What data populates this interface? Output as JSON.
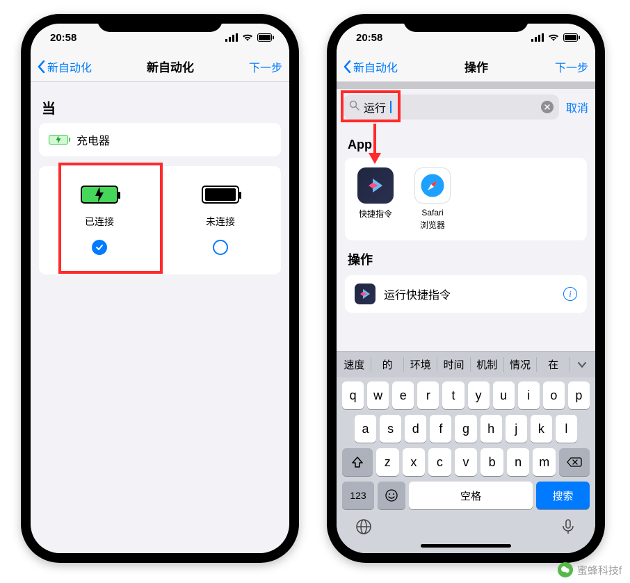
{
  "statusbar": {
    "time": "20:58"
  },
  "left": {
    "nav": {
      "back": "新自动化",
      "title": "新自动化",
      "next": "下一步"
    },
    "section_label": "当",
    "charger_label": "充电器",
    "option_connected": "已连接",
    "option_disconnected": "未连接"
  },
  "right": {
    "nav": {
      "back": "新自动化",
      "title": "操作",
      "next": "下一步"
    },
    "search": {
      "query": "运行",
      "cancel": "取消"
    },
    "section_app": "App",
    "apps": {
      "shortcuts": {
        "name": "快捷指令"
      },
      "safari": {
        "name1": "Safari",
        "name2": "浏览器"
      }
    },
    "section_actions": "操作",
    "action_run": "运行快捷指令",
    "suggestions": [
      "速度",
      "的",
      "环境",
      "时间",
      "机制",
      "情况",
      "在"
    ],
    "keys_r1": [
      "q",
      "w",
      "e",
      "r",
      "t",
      "y",
      "u",
      "i",
      "o",
      "p"
    ],
    "keys_r2": [
      "a",
      "s",
      "d",
      "f",
      "g",
      "h",
      "j",
      "k",
      "l"
    ],
    "keys_r3": [
      "z",
      "x",
      "c",
      "v",
      "b",
      "n",
      "m"
    ],
    "key_num": "123",
    "key_space": "空格",
    "key_search": "搜索"
  },
  "watermark": "蜜蜂科技f"
}
